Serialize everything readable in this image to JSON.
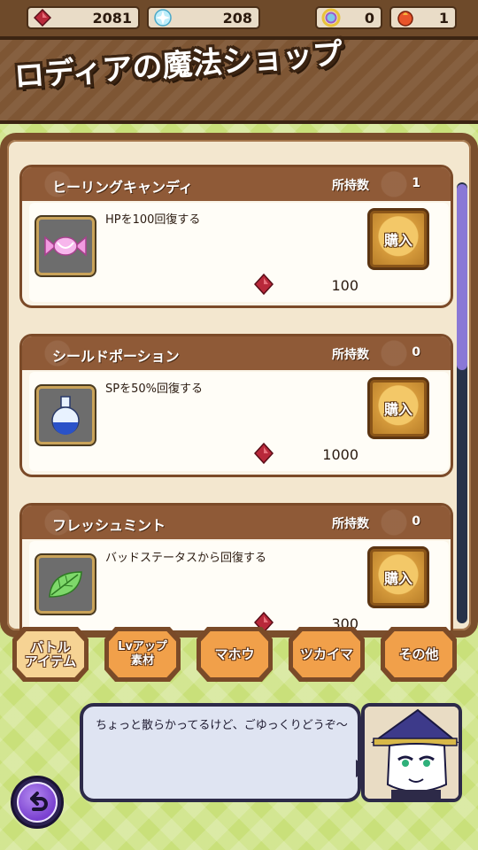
{
  "resources": [
    {
      "name": "red-gem",
      "value": "2081",
      "icon": "red-gem-icon",
      "color": "#c0293a"
    },
    {
      "name": "blue-crystal",
      "value": "208",
      "icon": "crystal-icon",
      "color": "#8fd9f0"
    },
    {
      "name": "rainbow-orb",
      "value": "0",
      "icon": "rainbow-orb-icon",
      "color": "#9fd06a"
    },
    {
      "name": "fire-orb",
      "value": "1",
      "icon": "fire-orb-icon",
      "color": "#e85a2a"
    }
  ],
  "title": "ロディアの魔法ショップ",
  "items": [
    {
      "name": "ヒーリングキャンディ",
      "owned_label": "所持数",
      "owned": "1",
      "description": "HPを100回復する",
      "price": "100",
      "buy_label": "購入",
      "icon": "candy-icon"
    },
    {
      "name": "シールドポーション",
      "owned_label": "所持数",
      "owned": "0",
      "description": "SPを50%回復する",
      "price": "1000",
      "buy_label": "購入",
      "icon": "potion-icon"
    },
    {
      "name": "フレッシュミント",
      "owned_label": "所持数",
      "owned": "0",
      "description": "バッドステータスから回復する",
      "price": "300",
      "buy_label": "購入",
      "icon": "mint-leaf-icon"
    }
  ],
  "tabs": [
    {
      "label": "バトル\nアイテム",
      "active": true
    },
    {
      "label": "Lvアップ\n素材",
      "active": false
    },
    {
      "label": "マホウ",
      "active": false
    },
    {
      "label": "ツカイマ",
      "active": false
    },
    {
      "label": "その他",
      "active": false
    }
  ],
  "dialog": {
    "text": "ちょっと散らかってるけど、ごゆっくりどうぞ～"
  },
  "colors": {
    "accent_brown": "#7a4e2c",
    "tab_orange": "#f1a04a",
    "scroll_thumb": "#8a78d6"
  }
}
